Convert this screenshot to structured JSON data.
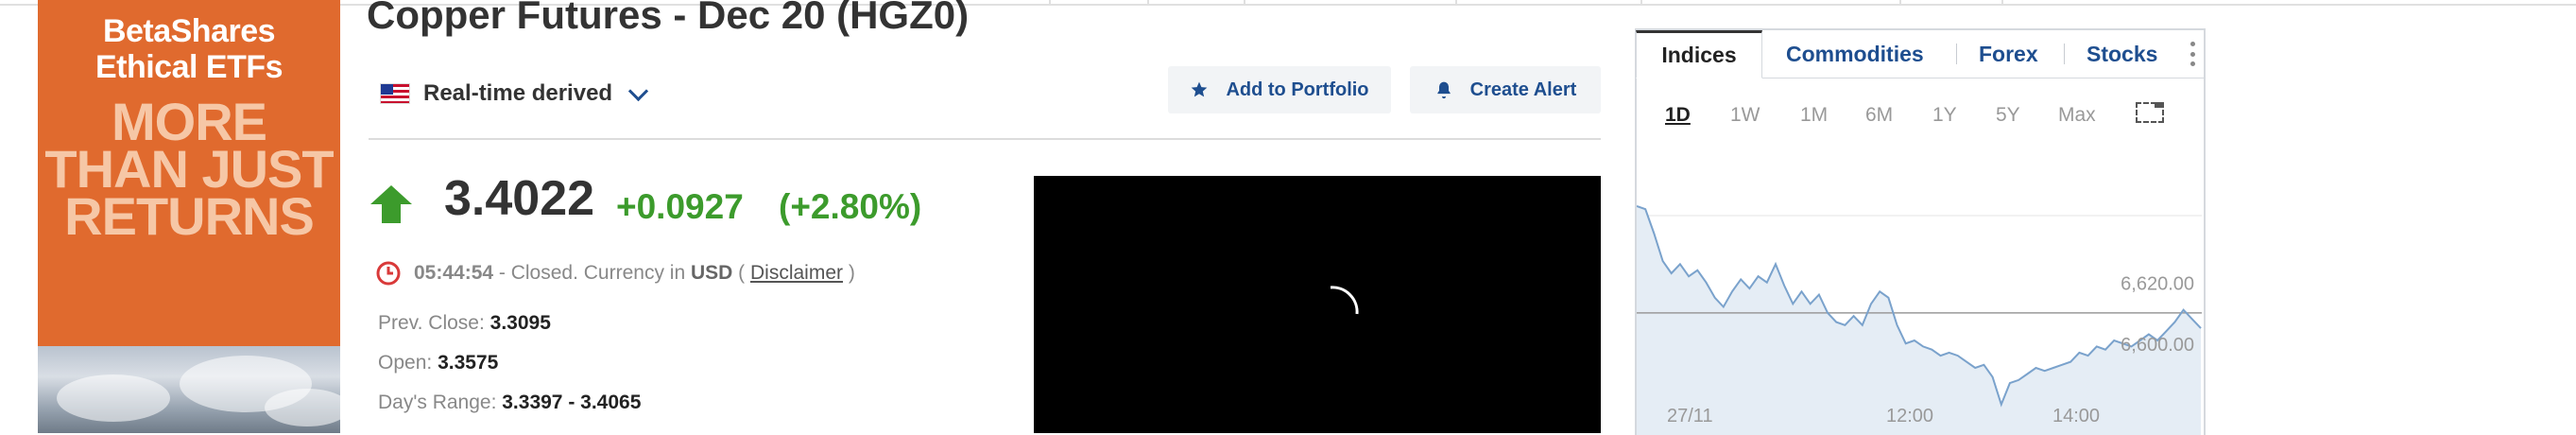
{
  "ad": {
    "brand_line1": "BetaShares",
    "brand_line2": "Ethical ETFs",
    "slogan_line1": "MORE",
    "slogan_line2": "THAN JUST",
    "slogan_line3": "RETURNS",
    "bg_color": "#e06a2e"
  },
  "header": {
    "title": "Copper Futures - Dec 20 (HGZ0)",
    "realtime_label": "Real-time derived",
    "flag_icon": "us-flag-icon",
    "add_portfolio_label": "Add to Portfolio",
    "create_alert_label": "Create Alert"
  },
  "quote": {
    "price": "3.4022",
    "change": "+0.0927",
    "change_pct": "(+2.80%)",
    "direction": "up",
    "up_color": "#3c9b2c",
    "time": "05:44:54",
    "status_text": " - Closed. Currency in ",
    "currency": "USD",
    "paren_open": " ( ",
    "disclaimer": "Disclaimer",
    "paren_close": " )",
    "prev_close_label": "Prev. Close:",
    "prev_close": "3.3095",
    "open_label": "Open:",
    "open": "3.3575",
    "days_range_label": "Day's Range:",
    "days_range": "3.3397 - 3.4065"
  },
  "widget": {
    "tabs": [
      "Indices",
      "Commodities",
      "Forex",
      "Stocks"
    ],
    "active_tab": "Indices",
    "ranges": [
      "1D",
      "1W",
      "1M",
      "6M",
      "1Y",
      "5Y",
      "Max"
    ],
    "active_range": "1D",
    "chart_data": {
      "type": "area",
      "x_labels": [
        "27/11",
        "12:00",
        "14:00"
      ],
      "y_labels": [
        "6,620.00",
        "6,600.00"
      ],
      "reference_line": 6610,
      "ylim": [
        6570,
        6645
      ],
      "line_color": "#7aa2cc",
      "fill_color": "#e5edf5",
      "series": [
        {
          "values": [
            6645,
            6644,
            6636,
            6627,
            6623,
            6626,
            6622,
            6624,
            6620,
            6615,
            6612,
            6617,
            6621,
            6618,
            6622,
            6620,
            6626,
            6619,
            6613,
            6617,
            6613,
            6616,
            6610,
            6607,
            6606,
            6609,
            6606,
            6613,
            6617,
            6615,
            6606,
            6600,
            6601,
            6599,
            6598,
            6596,
            6597,
            6596,
            6594,
            6592,
            6593,
            6589,
            6580,
            6587,
            6588,
            6590,
            6592,
            6591,
            6592,
            6593,
            6594,
            6597,
            6596,
            6599,
            6598,
            6601,
            6600,
            6599,
            6601,
            6603,
            6601,
            6604,
            6607,
            6611,
            6608,
            6605
          ]
        }
      ]
    }
  }
}
